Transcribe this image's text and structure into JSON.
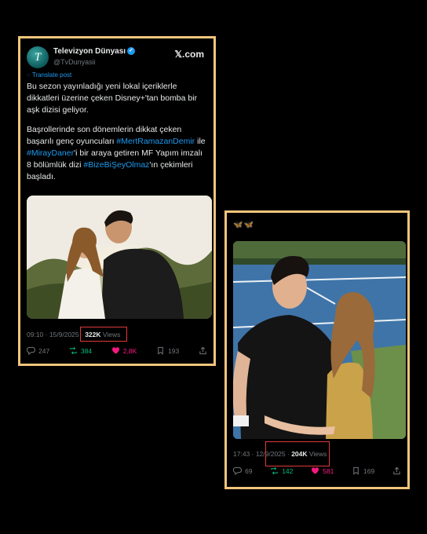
{
  "post1": {
    "name": "Televizyon Dünyası",
    "handle": "@TvDunyasii",
    "brand": "𝕏.com",
    "avatar_letter": "T",
    "translate": "Translate post",
    "p1": "Bu sezon yayınladığı yeni lokal içeriklerle dikkatleri üzerine çeken Disney+'tan bomba bir aşk dizisi geliyor.",
    "p2a": "Başrollerinde son dönemlerin dikkat çeken başarılı genç oyuncuları ",
    "h1": "#MertRamazanDemir",
    "p2b": " ile ",
    "h2": "#MirayDaner",
    "p2c": "'i bir araya getiren MF Yapım imzalı  8 bölümlük dizi ",
    "h3": "#BizeBiŞeyOlmaz",
    "p2d": "'ın çekimleri başladı.",
    "time": "09:10 · 15/9/2025 · ",
    "views": "322K",
    "views_label": " Views",
    "replies": "247",
    "reposts": "384",
    "likes": "2,8K",
    "bookmarks": "193"
  },
  "post2": {
    "butterflies": "🦋🦋",
    "time": "17:43 · 12/9/2025 · ",
    "views": "204K",
    "views_label": " Views",
    "replies": "69",
    "reposts": "142",
    "likes": "581",
    "bookmarks": "169"
  },
  "colors": {
    "frame": "#f2c57c",
    "highlight": "#e03a3a",
    "link": "#1d9bf0",
    "repost": "#00ba7c",
    "like": "#f91880"
  }
}
